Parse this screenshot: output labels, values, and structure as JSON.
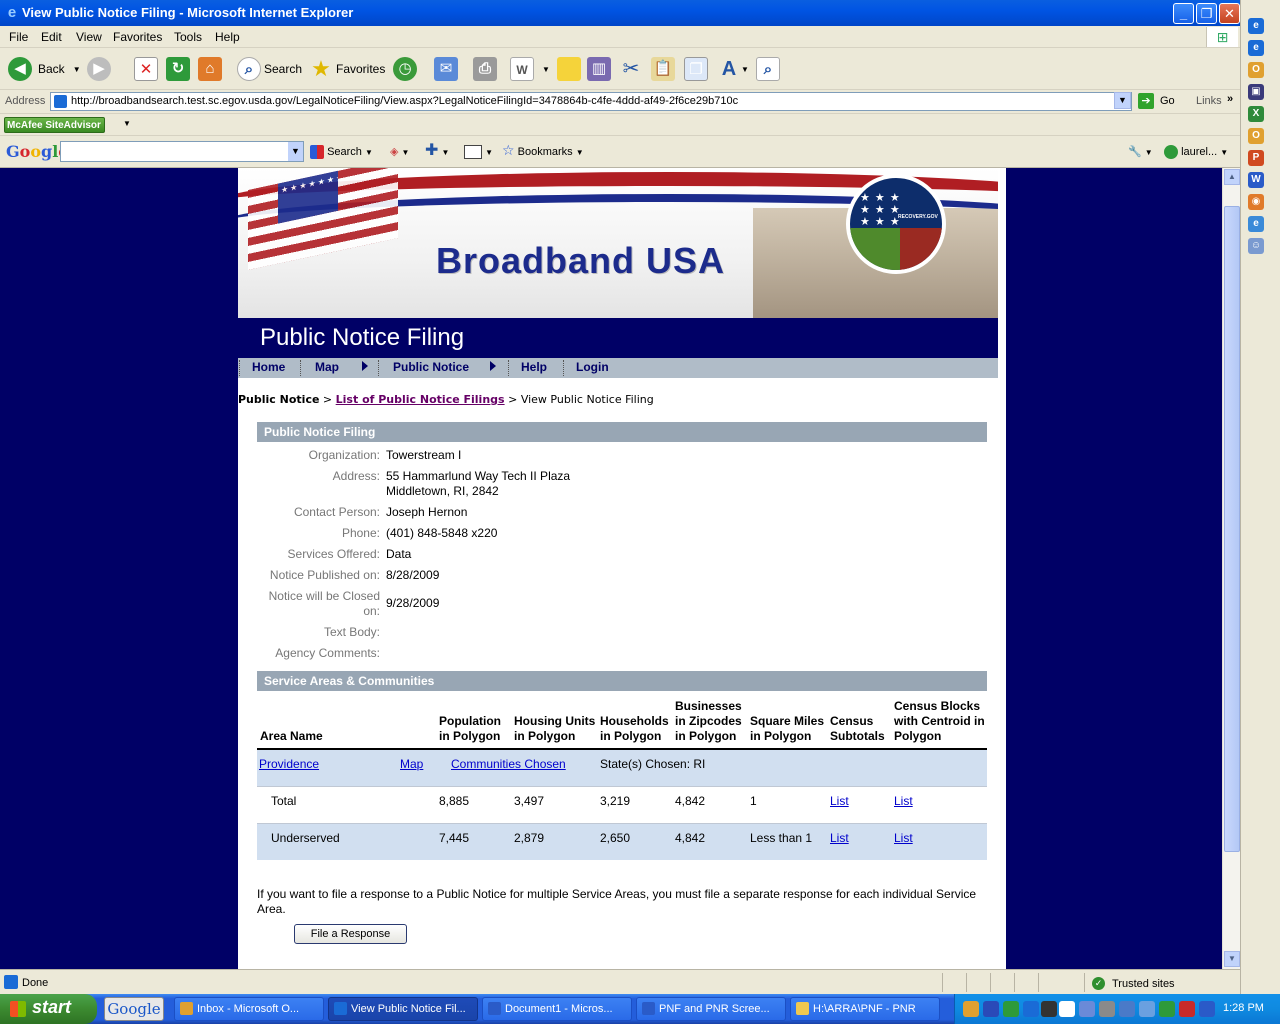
{
  "window": {
    "title": "View Public Notice Filing - Microsoft Internet Explorer"
  },
  "menu": [
    "File",
    "Edit",
    "View",
    "Favorites",
    "Tools",
    "Help"
  ],
  "toolbar": {
    "back": "Back",
    "search": "Search",
    "favorites": "Favorites"
  },
  "address": {
    "label": "Address",
    "url": "http://broadbandsearch.test.sc.egov.usda.gov/LegalNoticeFiling/View.aspx?LegalNoticeFilingId=3478864b-c4fe-4ddd-af49-2f6ce29b710c",
    "go": "Go",
    "links": "Links"
  },
  "mcafee": {
    "label": "McAfee SiteAdvisor"
  },
  "googlebar": {
    "logo": "Google",
    "search": "Search",
    "bookmarks": "Bookmarks",
    "user": "laurel..."
  },
  "banner": {
    "brand": "Broadband USA",
    "seal_text": "RECOVERY.GOV"
  },
  "page": {
    "header": "Public Notice Filing",
    "nav": [
      "Home",
      "Map",
      "Public Notice",
      "Help",
      "Login"
    ],
    "breadcrumb": {
      "root": "Public Notice",
      "sep1": " > ",
      "link": "List of Public Notice Filings",
      "sep2": " > ",
      "current": "View Public Notice Filing"
    }
  },
  "filing": {
    "section_title": "Public Notice Filing",
    "fields": {
      "organization": {
        "label": "Organization:",
        "value": "Towerstream I"
      },
      "address": {
        "label": "Address:",
        "line1": "55 Hammarlund Way Tech II Plaza",
        "line2": "Middletown, RI, 2842"
      },
      "contact": {
        "label": "Contact Person:",
        "value": "Joseph Hernon"
      },
      "phone": {
        "label": "Phone:",
        "value": "(401) 848-5848 x220"
      },
      "services": {
        "label": "Services Offered:",
        "value": "Data"
      },
      "published": {
        "label": "Notice Published on:",
        "value": "8/28/2009"
      },
      "closed": {
        "label_line1": "Notice will be Closed",
        "label_line2": "on:",
        "value": "9/28/2009"
      },
      "text_body": {
        "label": "Text Body:",
        "value": ""
      },
      "agency_comments": {
        "label": "Agency Comments:",
        "value": ""
      }
    }
  },
  "service_areas": {
    "section_title": "Service Areas & Communities",
    "columns": {
      "area_name": [
        "Area Name"
      ],
      "population": [
        "Population",
        "in Polygon"
      ],
      "housing": [
        "Housing Units",
        "in Polygon"
      ],
      "households": [
        "Households",
        "in Polygon"
      ],
      "businesses": [
        "Businesses",
        "in Zipcodes",
        "in Polygon"
      ],
      "sq_miles": [
        "Square Miles",
        "in Polygon"
      ],
      "census_sub": [
        "Census",
        "Subtotals"
      ],
      "census_blocks": [
        "Census Blocks",
        "with Centroid in",
        "Polygon"
      ]
    },
    "area": {
      "name": "Providence",
      "map": "Map",
      "communities": "Communities Chosen",
      "states": "State(s) Chosen: RI"
    },
    "rows": [
      {
        "label": "Total",
        "population": "8,885",
        "housing": "3,497",
        "households": "3,219",
        "businesses": "4,842",
        "sq_miles": "1",
        "census_sub": "List",
        "census_blocks": "List"
      },
      {
        "label": "Underserved",
        "population": "7,445",
        "housing": "2,879",
        "households": "2,650",
        "businesses": "4,842",
        "sq_miles": "Less than 1",
        "census_sub": "List",
        "census_blocks": "List"
      }
    ],
    "note": "If you want to file a response to a Public Notice for multiple Service Areas, you must file a separate response for each individual Service Area.",
    "button": "File a Response"
  },
  "status": {
    "text": "Done",
    "zone": "Trusted sites"
  },
  "taskbar": {
    "start": "start",
    "google": "Google",
    "tasks": [
      "Inbox - Microsoft O...",
      "View Public Notice Fil...",
      "Document1 - Micros...",
      "PNF and PNR Scree...",
      "H:\\ARRA\\PNF - PNR"
    ],
    "clock": "1:28 PM"
  },
  "colors": {
    "navy": "#000066",
    "section_gray": "#98a6b4",
    "row_blue": "#d1dff0",
    "link_blue": "#0000cc",
    "visited_purple": "#660066"
  }
}
